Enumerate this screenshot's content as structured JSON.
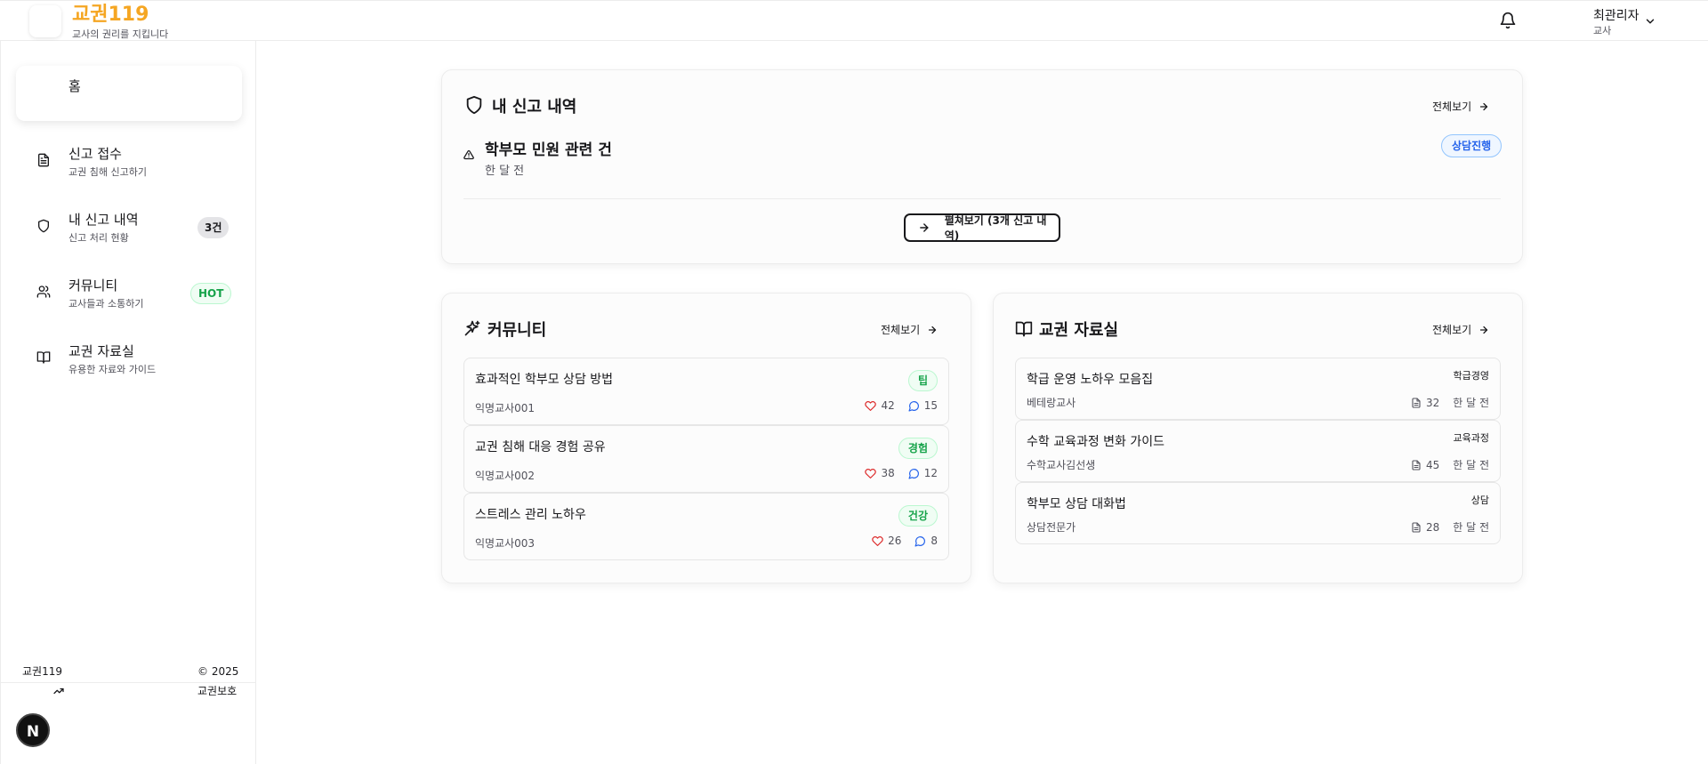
{
  "header": {
    "logo_title": "교권119",
    "logo_sub": "교사의 권리를 지킵니다",
    "user_name": "최관리자",
    "user_role": "교사",
    "icons": [
      "bell-icon",
      "chevron-down-icon"
    ]
  },
  "sidebar": {
    "home_label": "홈",
    "items": [
      {
        "label": "신고 접수",
        "sub": "교권 침해 신고하기",
        "icon": "file-text-icon"
      },
      {
        "label": "내 신고 내역",
        "sub": "신고 처리 현황",
        "icon": "shield-icon",
        "badge": "3건"
      },
      {
        "label": "커뮤니티",
        "sub": "교사들과 소통하기",
        "icon": "users-icon",
        "badge": "HOT"
      },
      {
        "label": "교권 자료실",
        "sub": "유용한 자료와 가이드",
        "icon": "book-open-icon"
      }
    ],
    "footer": {
      "brand": "교권119",
      "copyright": "© 2025",
      "org": "교권보호",
      "avatar_letter": "N"
    }
  },
  "reports": {
    "title": "내 신고 내역",
    "view_all": "전체보기",
    "item": {
      "title": "학부모 민원 관련 건",
      "time": "한 달 전",
      "status": "상담진행"
    },
    "expand_label": "펼쳐보기 (3개 신고 내역)"
  },
  "community": {
    "title": "커뮤니티",
    "view_all": "전체보기",
    "posts": [
      {
        "title": "효과적인 학부모 상담 방법",
        "author": "익명교사001",
        "tag": "팁",
        "likes": "42",
        "comments": "15"
      },
      {
        "title": "교권 침해 대응 경험 공유",
        "author": "익명교사002",
        "tag": "경험",
        "likes": "38",
        "comments": "12"
      },
      {
        "title": "스트레스 관리 노하우",
        "author": "익명교사003",
        "tag": "건강",
        "likes": "26",
        "comments": "8"
      }
    ]
  },
  "library": {
    "title": "교권 자료실",
    "view_all": "전체보기",
    "docs": [
      {
        "title": "학급 운영 노하우 모음집",
        "author": "베테랑교사",
        "category": "학급경영",
        "count": "32",
        "time": "한 달 전"
      },
      {
        "title": "수학 교육과정 변화 가이드",
        "author": "수학교사김선생",
        "category": "교육과정",
        "count": "45",
        "time": "한 달 전"
      },
      {
        "title": "학부모 상담 대화법",
        "author": "상담전문가",
        "category": "상담",
        "count": "28",
        "time": "한 달 전"
      }
    ]
  },
  "colors": {
    "brand": "#f5a623",
    "status_blue": "#2563eb",
    "tag_green": "#16a34a",
    "heart_red": "#dc2626",
    "comment_blue": "#2563eb"
  }
}
